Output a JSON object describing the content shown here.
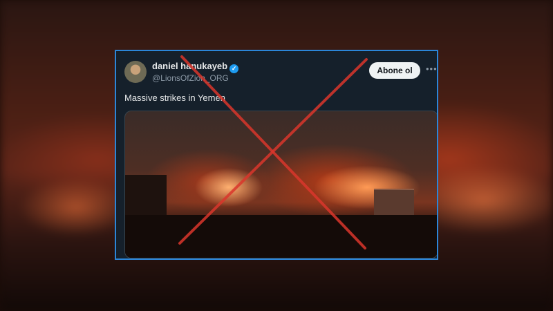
{
  "tweet": {
    "author_name": "daniel hanukayeb",
    "handle": "@LionsOfZion_ORG",
    "follow_label": "Abone ol",
    "more_icon": "more-horizontal-icon",
    "verified_icon": "verified-badge-icon",
    "text": "Massive strikes in Yemen"
  },
  "overlay": {
    "cross_icon": "red-x-mark",
    "cross_color": "#d9362b"
  },
  "colors": {
    "card_bg": "#15202b",
    "card_border": "#2b86d9",
    "verified": "#1d9bf0"
  }
}
